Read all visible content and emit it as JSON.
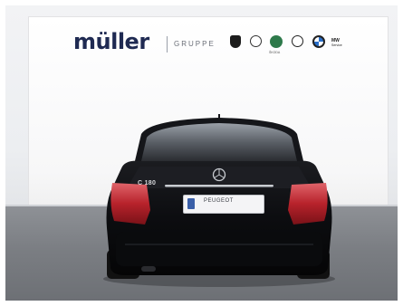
{
  "backdrop": {
    "brand": "müller",
    "brand_sub": "GRUPPE",
    "partner_logos": [
      "peugeot-logo",
      "volkswagen-logo",
      "skoda-logo",
      "opel-logo",
      "bmw-logo",
      "mw-service-logo"
    ],
    "skoda_label": "ŠKODA",
    "mw_label_line1": "MW",
    "mw_label_line2": "Service"
  },
  "vehicle": {
    "model_badge": "C 180",
    "plate_dealer": "PEUGEOT"
  },
  "colors": {
    "brand_navy": "#1f2a52",
    "paint": "#0e0f12",
    "taillight": "#c0262e",
    "floor": "#7b7e83"
  }
}
